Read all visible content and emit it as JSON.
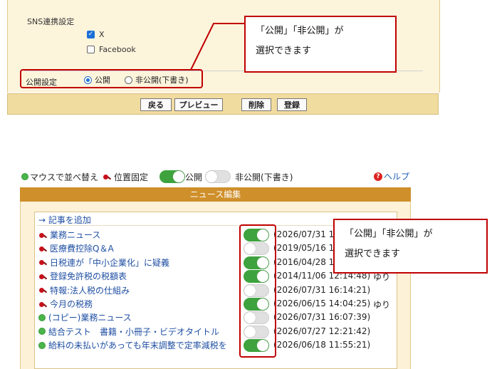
{
  "sns_settings": {
    "title": "SNS連携設定",
    "options": [
      {
        "label": "X",
        "checked": true
      },
      {
        "label": "Facebook",
        "checked": false
      }
    ]
  },
  "visibility": {
    "label": "公開設定",
    "options": [
      {
        "label": "公開",
        "selected": true
      },
      {
        "label": "非公開(下書き)",
        "selected": false
      }
    ]
  },
  "buttons": {
    "back": "戻る",
    "preview": "プレビュー",
    "delete": "削除",
    "register": "登録"
  },
  "callout_top": {
    "line1": "「公開」「非公開」が",
    "line2": "選択できます"
  },
  "callout_bottom": {
    "line1": "「公開」「非公開」が",
    "line2": "選択できます"
  },
  "legend": {
    "sort": "マウスで並べ替え",
    "pin": "位置固定",
    "public": "公開",
    "private": "非公開(下書き)"
  },
  "help": "ヘルプ",
  "news": {
    "header": "ニュース編集",
    "add": "→ 記事を追加",
    "rows": [
      {
        "icon": "pin",
        "title": "業務ニュース",
        "public": true,
        "date": "(2026/07/31 16",
        "user": ""
      },
      {
        "icon": "pin",
        "title": "医療費控除Q＆A",
        "public": false,
        "date": "(2019/05/16 12",
        "user": ""
      },
      {
        "icon": "pin",
        "title": "日税連が「中小企業化」に疑義",
        "public": true,
        "date": "(2016/04/28 14",
        "user": ""
      },
      {
        "icon": "pin",
        "title": "登録免許税の税額表",
        "public": true,
        "date": "(2014/11/06 12:14:48)",
        "user": "ゆり"
      },
      {
        "icon": "pin",
        "title": "特報:法人税の仕組み",
        "public": false,
        "date": "(2026/07/31 16:14:21)",
        "user": ""
      },
      {
        "icon": "pin",
        "title": "今月の税務",
        "public": true,
        "date": "(2026/06/15 14:04:25)",
        "user": "ゆり"
      },
      {
        "icon": "dot",
        "title": "(コピー)業務ニュース",
        "public": false,
        "date": "(2026/07/31 16:07:39)",
        "user": ""
      },
      {
        "icon": "dot",
        "title": "結合テスト　書籍・小冊子・ビデオタイトル",
        "public": false,
        "date": "(2026/07/27 12:21:42)",
        "user": ""
      },
      {
        "icon": "dot",
        "title": "給料の未払いがあっても年末調整で定率減税を",
        "public": true,
        "date": "(2026/06/18 11:55:21)",
        "user": ""
      }
    ]
  },
  "colors": {
    "accent_red": "#c00000",
    "toggle_on": "#3ea33e",
    "header_orange": "#cf8f2a",
    "link_blue": "#1f4fa3"
  }
}
